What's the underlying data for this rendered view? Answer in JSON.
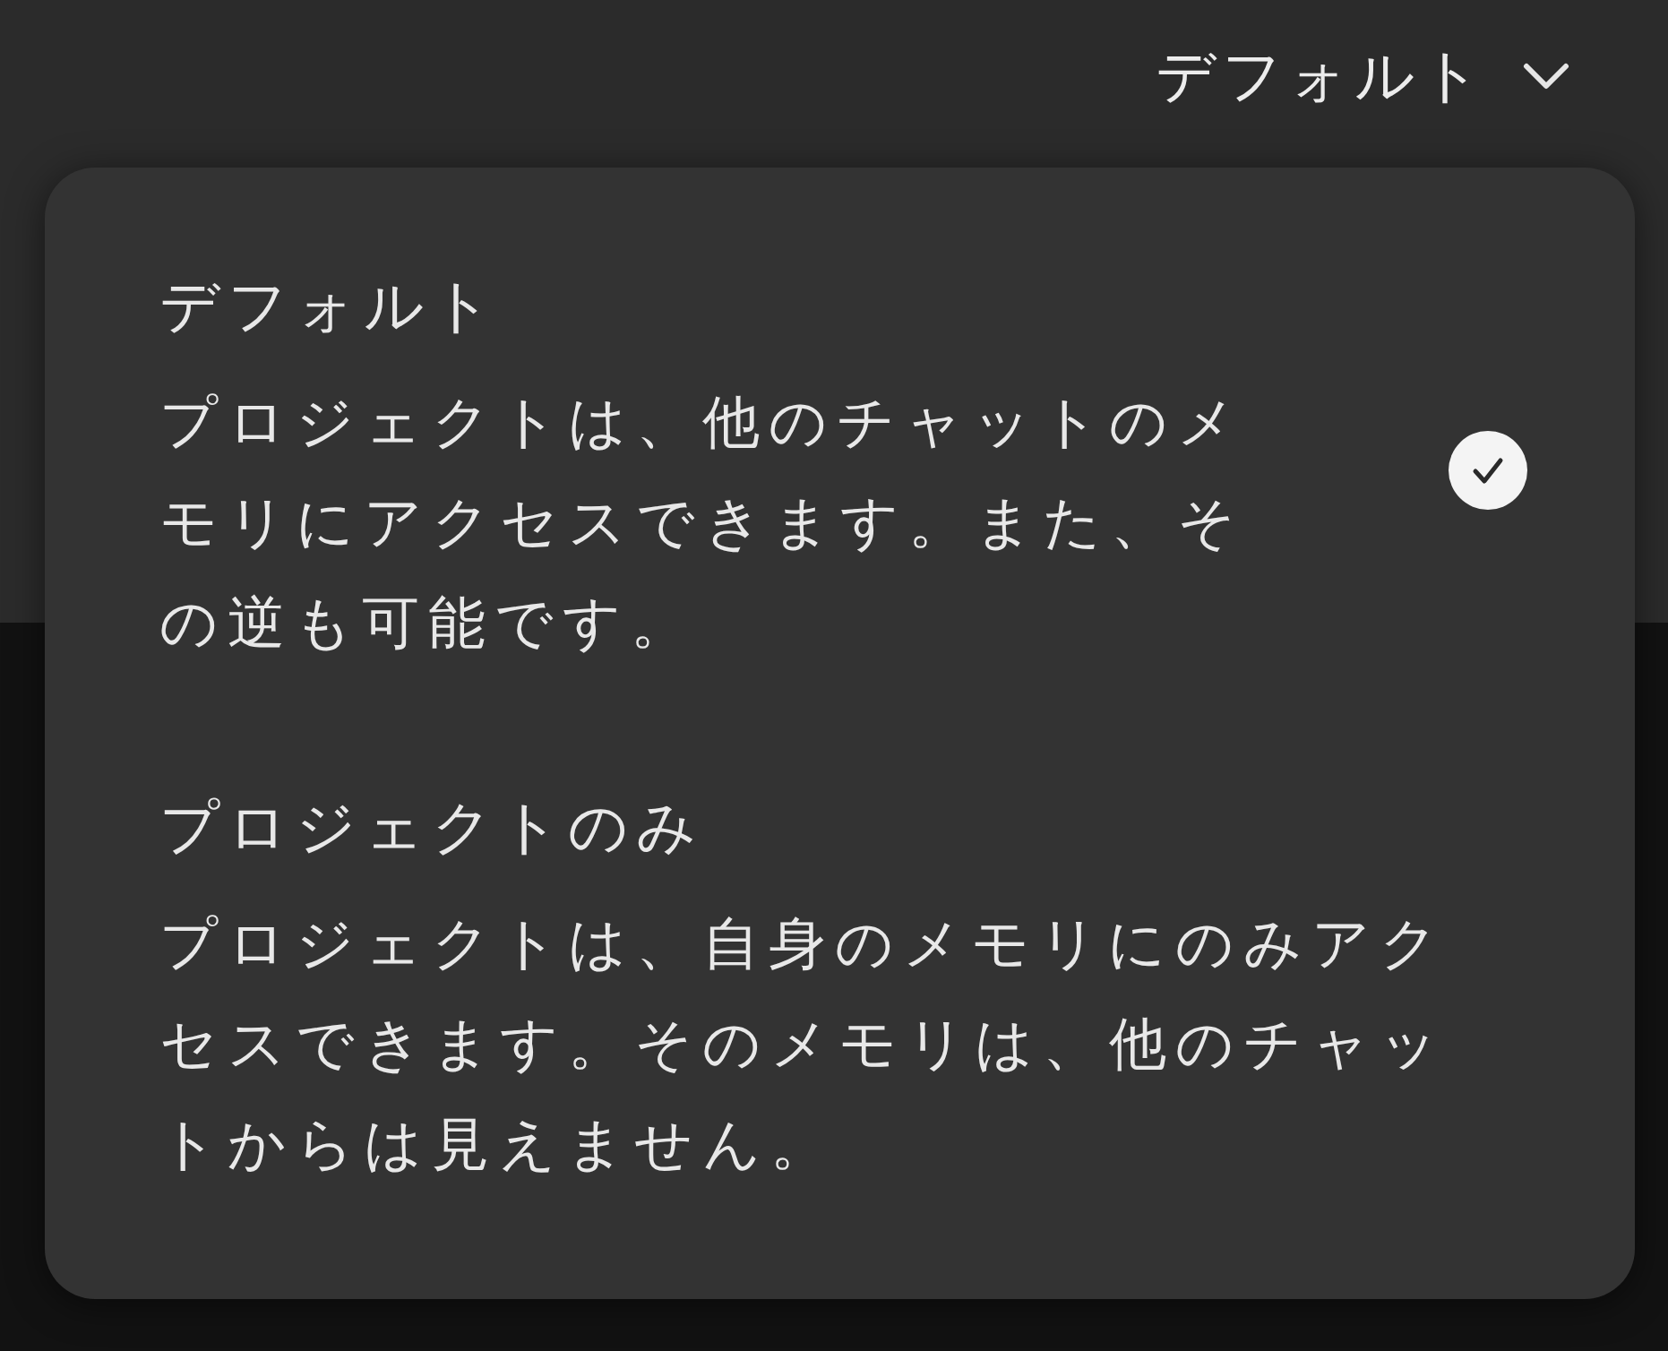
{
  "dropdown": {
    "label": "デフォルト"
  },
  "options": [
    {
      "title": "デフォルト",
      "description": "プロジェクトは、他のチャットのメモリにアクセスできます。また、その逆も可能です。",
      "selected": true
    },
    {
      "title": "プロジェクトのみ",
      "description": "プロジェクトは、自身のメモリにのみアクセスできます。そのメモリは、他のチャットからは見えません。",
      "selected": false
    }
  ]
}
